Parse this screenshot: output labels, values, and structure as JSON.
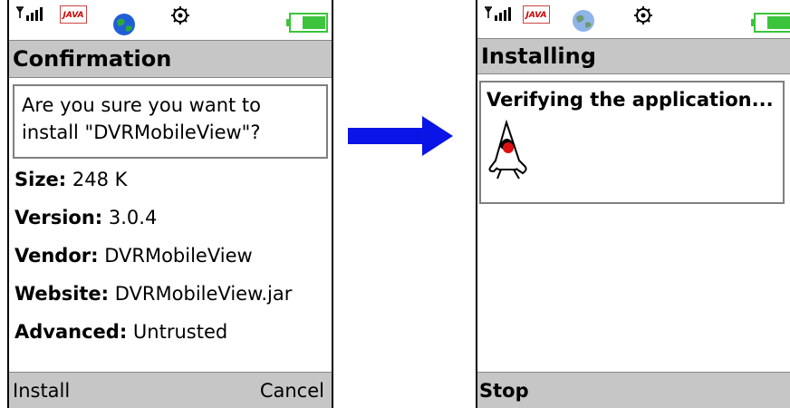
{
  "status_bar": {
    "java_label": "JAVA"
  },
  "confirmation_screen": {
    "title": "Confirmation",
    "question_line1": "Are you sure you want to",
    "question_line2": "install \"DVRMobileView\"?",
    "details": [
      {
        "label": "Size:",
        "value": "248 K"
      },
      {
        "label": "Version:",
        "value": "3.0.4"
      },
      {
        "label": "Vendor:",
        "value": "DVRMobileView"
      },
      {
        "label": "Website:",
        "value": "DVRMobileView.jar"
      },
      {
        "label": "Advanced:",
        "value": "Untrusted"
      }
    ],
    "softkeys": {
      "left": "Install",
      "right": "Cancel"
    }
  },
  "installing_screen": {
    "title": "Installing",
    "message": "Verifying the application...",
    "softkeys": {
      "left": "Stop"
    }
  },
  "colors": {
    "bar_gray": "#c6c6c6",
    "battery_green": "#3cc43c",
    "arrow_blue": "#0a14e6",
    "box_border": "#7f7f7f"
  },
  "icons": [
    "signal-icon",
    "java-icon",
    "globe-icon",
    "settings-icon",
    "battery-icon",
    "java-duke-icon",
    "arrow-icon"
  ]
}
